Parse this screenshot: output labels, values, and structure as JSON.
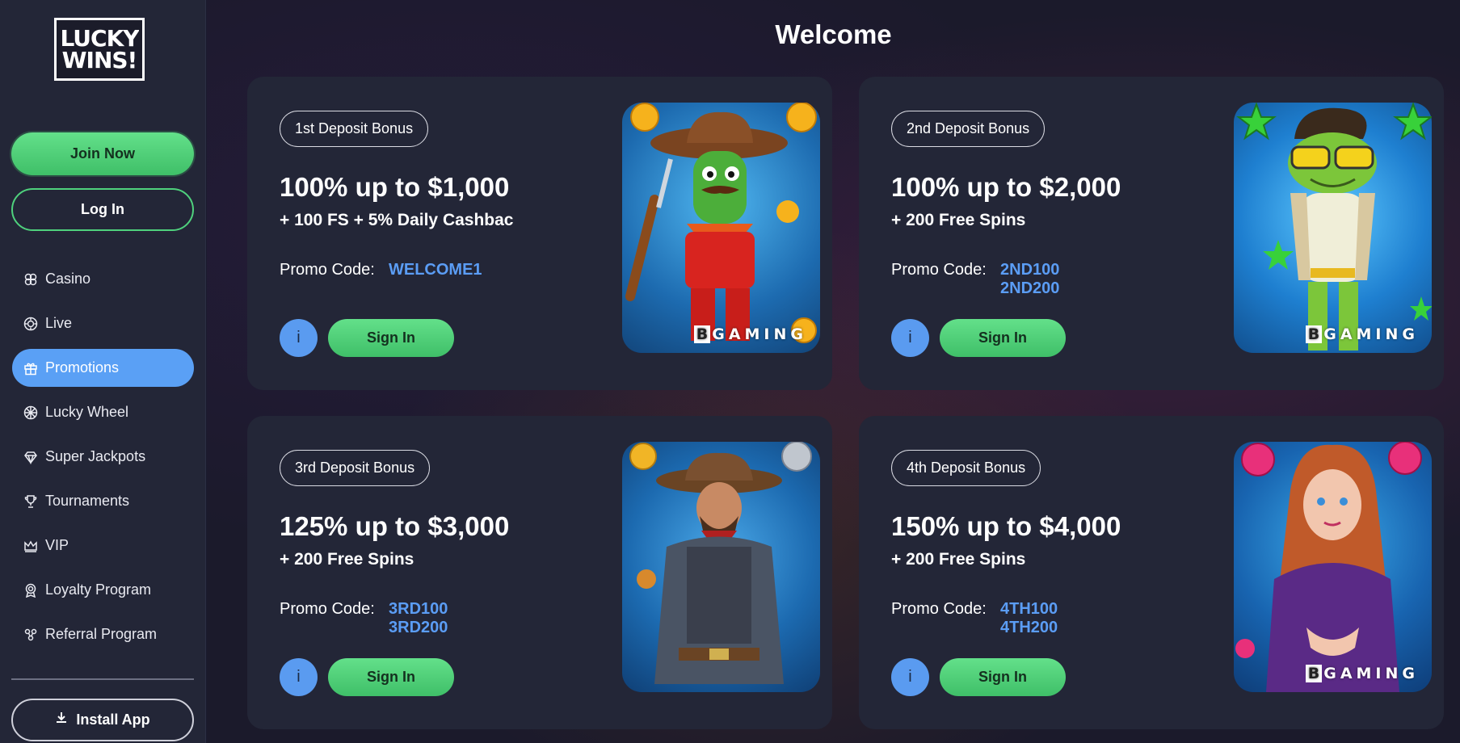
{
  "logo": {
    "line1": "LUCKY",
    "line2": "WINS!"
  },
  "auth": {
    "join_label": "Join Now",
    "login_label": "Log In"
  },
  "nav": {
    "items": [
      {
        "label": "Casino",
        "icon": "clover-icon"
      },
      {
        "label": "Live",
        "icon": "live-chip-icon"
      },
      {
        "label": "Promotions",
        "icon": "gift-icon",
        "active": true
      },
      {
        "label": "Lucky Wheel",
        "icon": "wheel-icon"
      },
      {
        "label": "Super Jackpots",
        "icon": "diamond-icon"
      },
      {
        "label": "Tournaments",
        "icon": "trophy-icon"
      },
      {
        "label": "VIP",
        "icon": "crown-icon"
      },
      {
        "label": "Loyalty Program",
        "icon": "medal-icon"
      },
      {
        "label": "Referral Program",
        "icon": "referral-icon"
      }
    ]
  },
  "install": {
    "label": "Install App",
    "icon": "download-icon"
  },
  "page": {
    "title": "Welcome"
  },
  "promo_label": "Promo Code:",
  "info_label": "i",
  "signin_label": "Sign In",
  "brand_label": "GAMING",
  "brand_letter": "B",
  "cards": [
    {
      "badge": "1st Deposit Bonus",
      "headline": "100% up to $1,000",
      "subline": "+ 100 FS + 5% Daily Cashbac",
      "codes": [
        "WELCOME1",
        ""
      ]
    },
    {
      "badge": "2nd Deposit Bonus",
      "headline": "100% up to $2,000",
      "subline": "+ 200 Free Spins",
      "codes": [
        "2ND100",
        "2ND200"
      ]
    },
    {
      "badge": "3rd Deposit Bonus",
      "headline": "125% up to $3,000",
      "subline": "+ 200 Free Spins",
      "codes": [
        "3RD100",
        "3RD200"
      ]
    },
    {
      "badge": "4th Deposit Bonus",
      "headline": "150% up to $4,000",
      "subline": "+ 200 Free Spins",
      "codes": [
        "4TH100",
        "4TH200"
      ]
    }
  ],
  "colors": {
    "accent_green": "#4fd17d",
    "accent_blue": "#5a9bf0",
    "card_bg": "#232637",
    "page_bg": "#1b1a2b"
  }
}
